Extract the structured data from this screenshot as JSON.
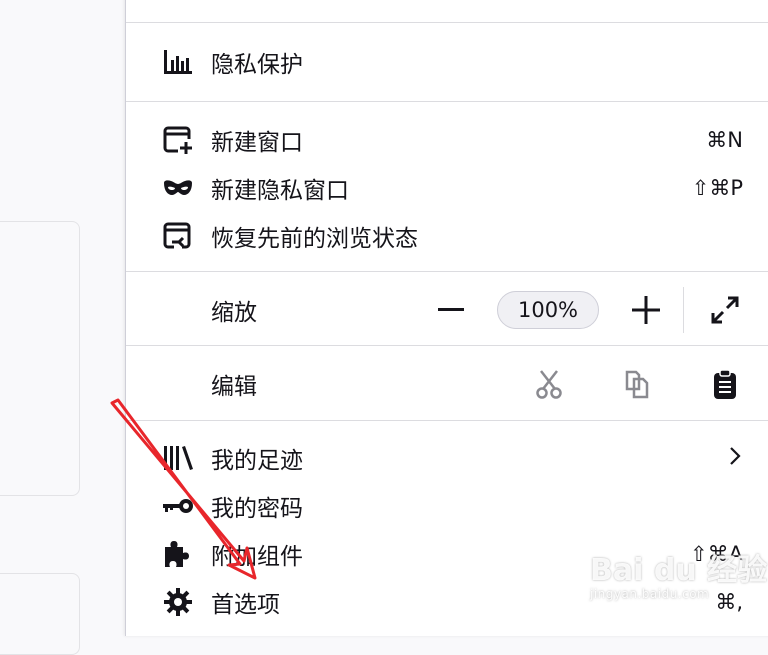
{
  "menu": {
    "privacy": {
      "label": "隐私保护",
      "icon": "privacy-chart-icon"
    },
    "new_window": {
      "label": "新建窗口",
      "shortcut": "⌘N",
      "icon": "new-window-icon"
    },
    "new_private_window": {
      "label": "新建隐私窗口",
      "shortcut": "⇧⌘P",
      "icon": "private-mask-icon"
    },
    "restore_session": {
      "label": "恢复先前的浏览状态",
      "icon": "restore-session-icon"
    },
    "zoom": {
      "label": "缩放",
      "value": "100%",
      "decrease_icon": "minus-icon",
      "increase_icon": "plus-icon",
      "fullscreen_icon": "fullscreen-icon"
    },
    "edit": {
      "label": "编辑",
      "cut_icon": "scissors-icon",
      "copy_icon": "copy-icon",
      "paste_icon": "clipboard-icon"
    },
    "library": {
      "label": "我的足迹",
      "icon": "library-icon",
      "chevron": "chevron-right-icon"
    },
    "passwords": {
      "label": "我的密码",
      "icon": "key-icon"
    },
    "addons": {
      "label": "附加组件",
      "shortcut": "⇧⌘A",
      "icon": "puzzle-icon"
    },
    "preferences": {
      "label": "首选项",
      "shortcut": "⌘,",
      "icon": "gear-icon"
    }
  },
  "annotation": {
    "arrow_color": "#e8262b"
  },
  "watermark": {
    "brand": "Bai du 经验",
    "url": "jingyan.baidu.com"
  },
  "colors": {
    "menu_bg": "#ffffff",
    "text": "#15141a",
    "separator": "#dcdce0",
    "page_bg": "#f9f9fb"
  }
}
